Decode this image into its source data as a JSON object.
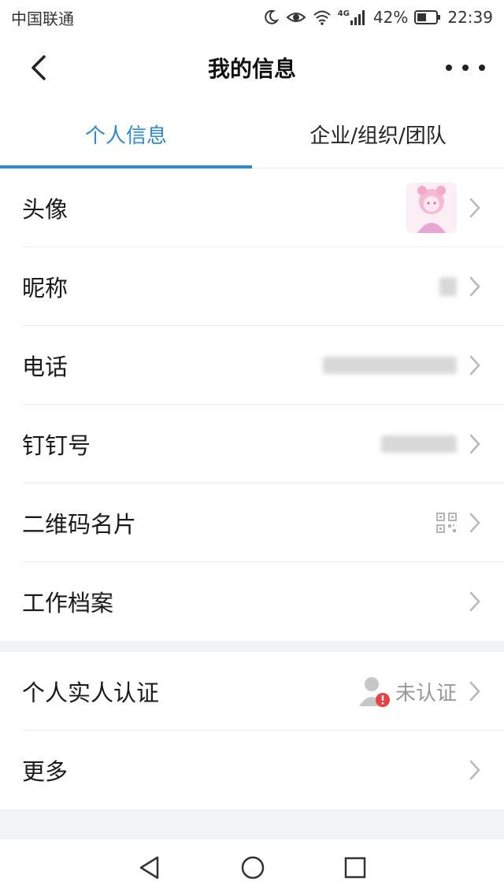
{
  "status_bar": {
    "carrier": "中国联通",
    "network": "4G",
    "battery": "42%",
    "time": "22:39"
  },
  "header": {
    "title": "我的信息"
  },
  "tabs": [
    {
      "label": "个人信息",
      "active": true
    },
    {
      "label": "企业/组织/团队",
      "active": false
    }
  ],
  "profile_rows": [
    {
      "label": "头像",
      "value": ""
    },
    {
      "label": "昵称",
      "value": ""
    },
    {
      "label": "电话",
      "value": ""
    },
    {
      "label": "钉钉号",
      "value": ""
    },
    {
      "label": "二维码名片",
      "value": ""
    },
    {
      "label": "工作档案",
      "value": ""
    }
  ],
  "other_rows": [
    {
      "label": "个人实人认证",
      "value": "未认证"
    },
    {
      "label": "更多",
      "value": ""
    }
  ],
  "colors": {
    "accent": "#2a8ad8",
    "alert": "#e8423f",
    "section_gap": "#f2f3f5"
  }
}
